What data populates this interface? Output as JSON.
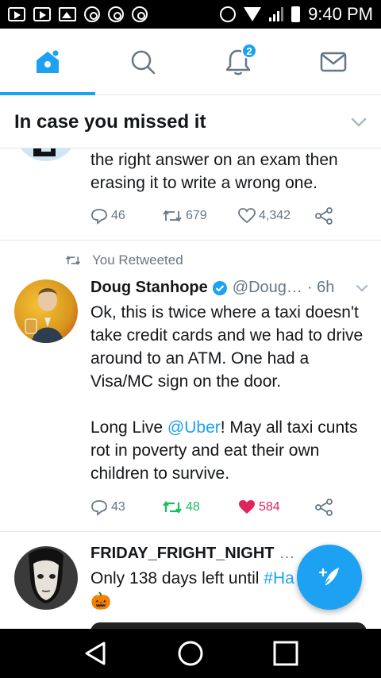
{
  "status_bar": {
    "time": "9:40 PM"
  },
  "tabs": [
    {
      "name": "home",
      "icon": "home-icon",
      "active": true
    },
    {
      "name": "search",
      "icon": "search-icon",
      "active": false
    },
    {
      "name": "notifications",
      "icon": "bell-icon",
      "badge": "2",
      "active": false
    },
    {
      "name": "messages",
      "icon": "envelope-icon",
      "active": false
    }
  ],
  "section": {
    "title": "In case you missed it"
  },
  "tweets": [
    {
      "text": "the right answer on an exam then erasing it to write a wrong one.",
      "replies": "46",
      "retweets": "679",
      "likes": "4,342"
    },
    {
      "retweeted_label": "You Retweeted",
      "name": "Doug Stanhope",
      "handle": "@Doug…",
      "time": "· 6h",
      "text_part1": "Ok, this is twice where a taxi doesn't take credit cards and we had to drive around to an ATM. One had a Visa/MC sign on the door.",
      "text_part2_prefix": "Long Live ",
      "mention": "@Uber",
      "text_part2_suffix": "! May all taxi cunts rot in poverty and eat their own children to survive.",
      "replies": "43",
      "retweets": "48",
      "likes": "584"
    },
    {
      "name": "FRIDAY_FRIGHT_NIGHT",
      "name_ellipsis": "…",
      "text_prefix": "Only 138 days left until ",
      "hashtag": "#Ha",
      "emoji": "🎃"
    }
  ],
  "colors": {
    "accent": "#1da1f2",
    "retweet_green": "#17bf63",
    "like_red": "#e0245e",
    "secondary_text": "#657786"
  }
}
